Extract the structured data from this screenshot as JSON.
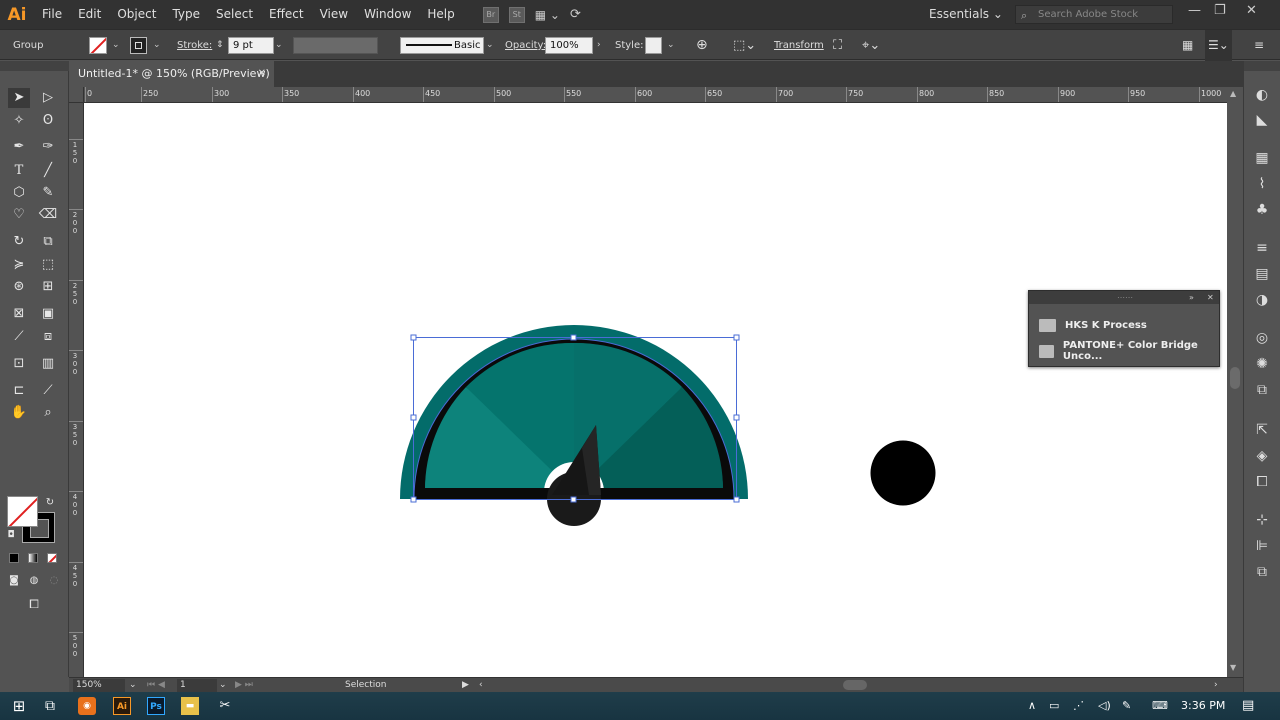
{
  "app": {
    "logo": "Ai"
  },
  "menu": [
    "File",
    "Edit",
    "Object",
    "Type",
    "Select",
    "Effect",
    "View",
    "Window",
    "Help"
  ],
  "menu_icons": {
    "br": "Br",
    "st": "St"
  },
  "workspace": {
    "label": "Essentials",
    "search_placeholder": "Search Adobe Stock"
  },
  "control": {
    "selection_type": "Group",
    "stroke_label": "Stroke:",
    "stroke_weight": "9 pt",
    "brush_profile": "Basic",
    "opacity_label": "Opacity:",
    "opacity_value": "100%",
    "style_label": "Style:",
    "transform_label": "Transform"
  },
  "document": {
    "tab_title": "Untitled-1* @ 150% (RGB/Preview)",
    "close": "✕"
  },
  "ruler_h": [
    "0",
    "250",
    "300",
    "350",
    "400",
    "450",
    "500",
    "550",
    "600",
    "650",
    "700",
    "750",
    "800",
    "850",
    "900",
    "950",
    "1000"
  ],
  "ruler_v": [
    "1\n5\n0",
    "2\n0\n0",
    "2\n5\n0",
    "3\n0\n0",
    "3\n5\n0",
    "4\n0\n0",
    "4\n5\n0",
    "5\n0\n0"
  ],
  "swatch_panel": {
    "items": [
      "HKS K Process",
      "PANTONE+ Color Bridge Unco..."
    ]
  },
  "status": {
    "zoom": "150%",
    "artboard": "1",
    "tool": "Selection"
  },
  "taskbar": {
    "time": "3:36 PM",
    "ai": "Ai",
    "ps": "Ps"
  },
  "colors": {
    "teal": "#036c6a",
    "teal_light": "#0e8079",
    "teal_dark": "#055e58",
    "accent": "#f79827"
  }
}
